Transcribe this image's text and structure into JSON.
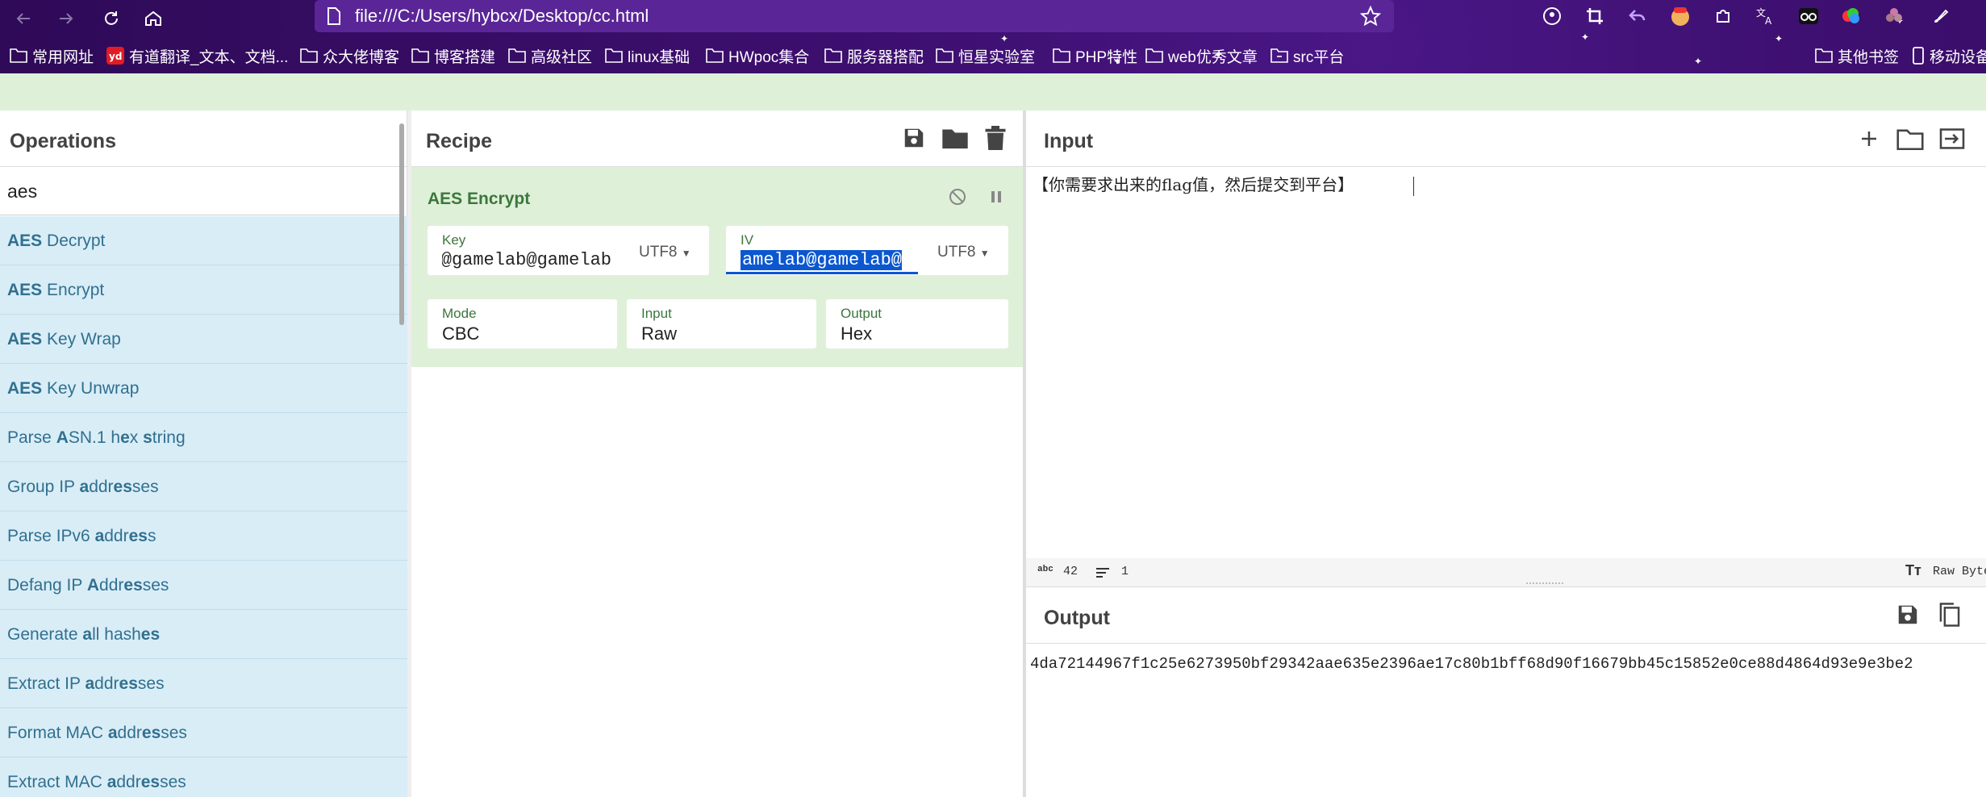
{
  "browser": {
    "url": "file:///C:/Users/hybcx/Desktop/cc.html",
    "bookmarks": [
      "常用网址",
      "有道翻译_文本、文档...",
      "众大佬博客",
      "博客搭建",
      "高级社区",
      "linux基础",
      "HWpoc集合",
      "服务器搭配",
      "恒星实验室",
      "PHP特性",
      "web优秀文章",
      "src平台",
      "其他书签",
      "移动设备"
    ]
  },
  "operations": {
    "title": "Operations",
    "search_value": "aes",
    "items": [
      {
        "pre": "",
        "hl": "AES",
        "post": " Decrypt"
      },
      {
        "pre": "",
        "hl": "AES",
        "post": " Encrypt"
      },
      {
        "pre": "",
        "hl": "AES",
        "post": " Key Wrap"
      },
      {
        "pre": "",
        "hl": "AES",
        "post": " Key Unwrap"
      },
      {
        "pre": "Parse ",
        "hl": "A",
        "post": "SN.1 h",
        "hl2": "e",
        "post2": "x ",
        "hl3": "s",
        "post3": "tring"
      },
      {
        "pre": "Group IP ",
        "hl": "a",
        "post": "ddr",
        "hl2": "es",
        "post2": "ses"
      },
      {
        "pre": "Parse IPv6 ",
        "hl": "a",
        "post": "ddr",
        "hl2": "es",
        "post2": "s"
      },
      {
        "pre": "Defang IP ",
        "hl": "A",
        "post": "ddr",
        "hl2": "es",
        "post2": "ses"
      },
      {
        "pre": "Generate ",
        "hl": "a",
        "post": "ll hash",
        "hl2": "es",
        "post2": ""
      },
      {
        "pre": "Extract IP ",
        "hl": "a",
        "post": "ddr",
        "hl2": "es",
        "post2": "ses"
      },
      {
        "pre": "Format MAC ",
        "hl": "a",
        "post": "ddr",
        "hl2": "es",
        "post2": "ses"
      },
      {
        "pre": "Extract MAC ",
        "hl": "a",
        "post": "ddr",
        "hl2": "es",
        "post2": "ses"
      }
    ]
  },
  "recipe": {
    "title": "Recipe",
    "operation": {
      "name": "AES Encrypt",
      "key_label": "Key",
      "key_value": "gamelab@gamelab@",
      "key_encoding": "UTF8",
      "iv_label": "IV",
      "iv_value": "gamelab@gamelab@",
      "iv_encoding": "UTF8",
      "mode_label": "Mode",
      "mode_value": "CBC",
      "input_label": "Input",
      "input_value": "Raw",
      "output_label": "Output",
      "output_value": "Hex"
    }
  },
  "input": {
    "title": "Input",
    "text": "【你需要求出来的flag值，然后提交到平台】",
    "length": "42",
    "lines": "1",
    "format_label": "Raw Bytes"
  },
  "output": {
    "title": "Output",
    "text": "4da72144967f1c25e6273950bf29342aae635e2396ae17c80b1bff68d90f16679bb45c15852e0ce88d4864d93e9e3be2"
  },
  "colors": {
    "accent_purple": "#3d0f6f",
    "op_highlight": "#d9edf7",
    "recipe_green": "#dff0d8",
    "selection_blue": "#0b57d0"
  }
}
